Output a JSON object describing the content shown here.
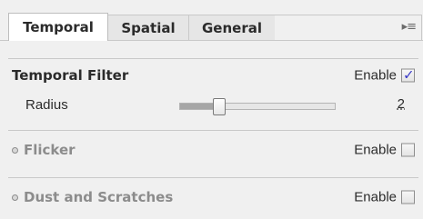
{
  "tabs": [
    {
      "label": "Temporal",
      "active": true
    },
    {
      "label": "Spatial",
      "active": false
    },
    {
      "label": "General",
      "active": false
    }
  ],
  "flyout_icon": "panel-menu-icon",
  "flyout_glyph": "▸≡",
  "sections": {
    "temporal_filter": {
      "title": "Temporal Filter",
      "enable_label": "Enable",
      "enabled": true,
      "check_glyph": "✓",
      "radius": {
        "label": "Radius",
        "value": "2",
        "slider_fraction": 0.25
      }
    },
    "flicker": {
      "title": "Flicker",
      "enable_label": "Enable",
      "enabled": false
    },
    "dust_and_scratches": {
      "title": "Dust and Scratches",
      "enable_label": "Enable",
      "enabled": false
    }
  },
  "colors": {
    "accent_check": "#3b3bc7",
    "panel_bg": "#f0f0f0",
    "disabled_text": "#8c8c8c"
  }
}
